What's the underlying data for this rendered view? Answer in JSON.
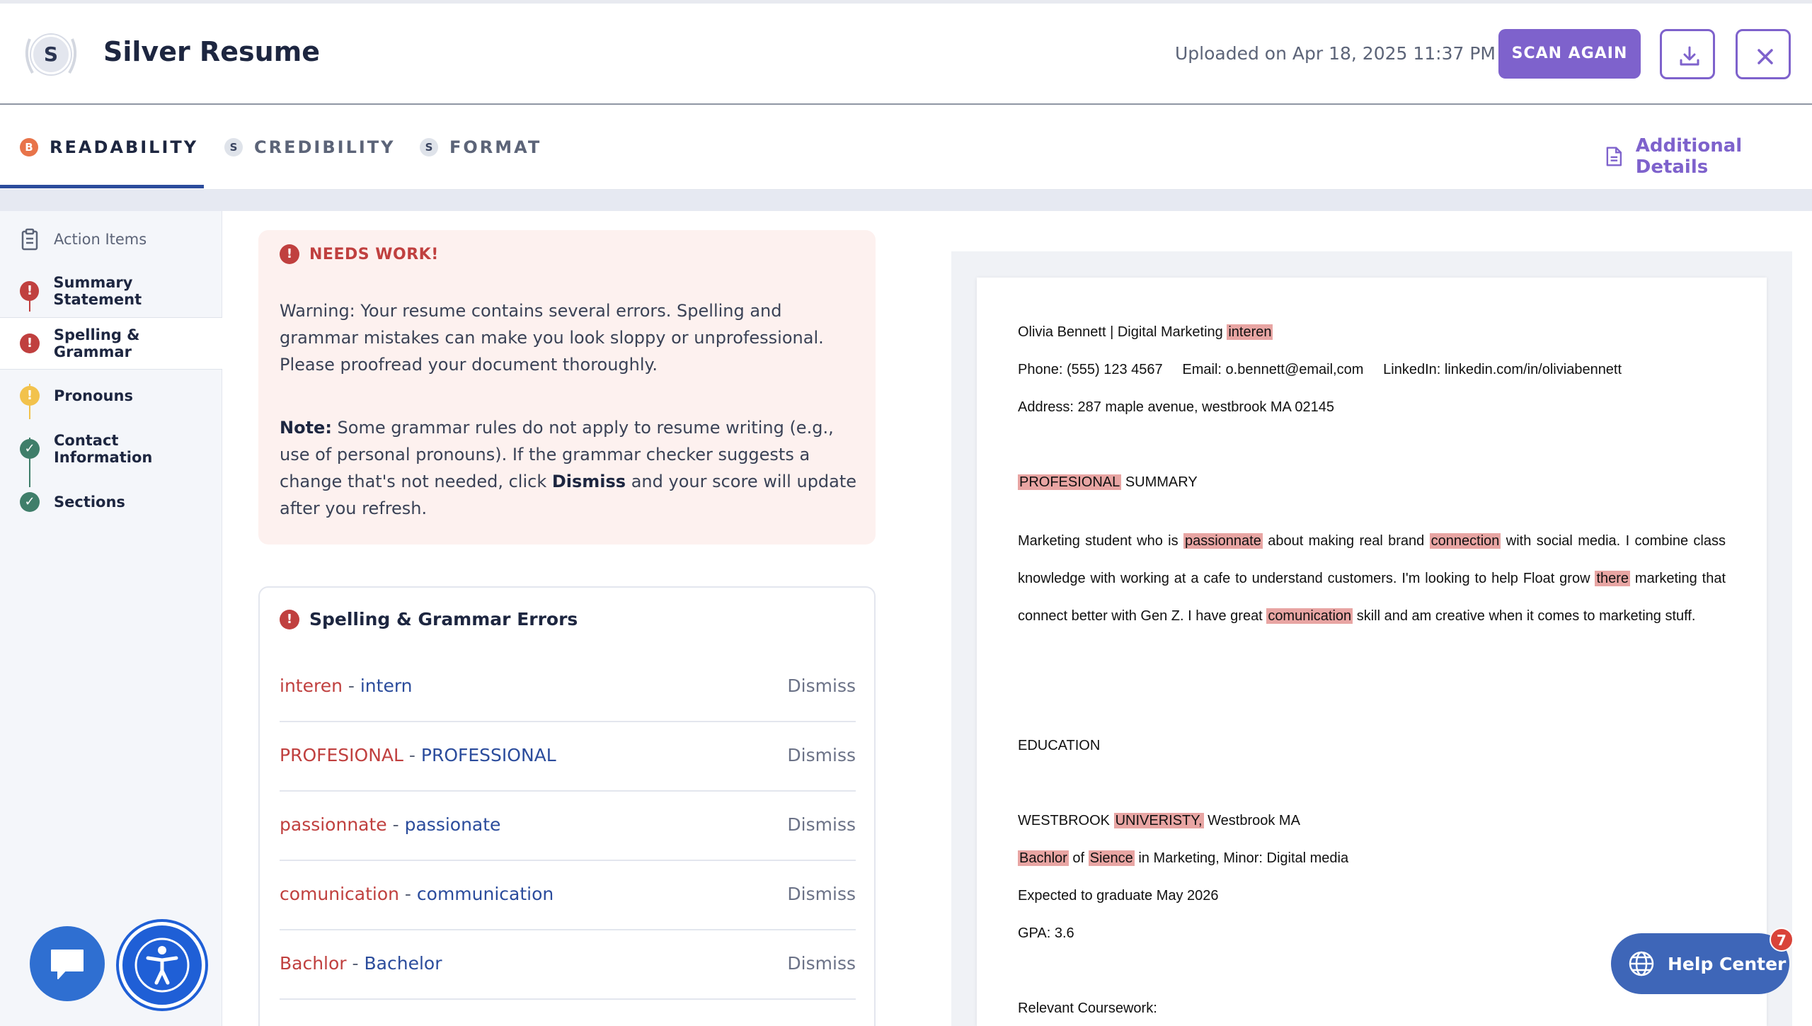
{
  "header": {
    "logo_letter": "S",
    "title": "Silver Resume",
    "uploaded": "Uploaded on Apr 18, 2025 11:37 PM",
    "scan_again": "SCAN AGAIN",
    "download_icon": "download-icon",
    "close_icon": "close-icon"
  },
  "tabs": [
    {
      "badge": "B",
      "label": "READABILITY",
      "active": true,
      "badge_color": "#e8744a"
    },
    {
      "badge": "S",
      "label": "CREDIBILITY",
      "active": false
    },
    {
      "badge": "S",
      "label": "FORMAT",
      "active": false
    }
  ],
  "additional_details": "Additional Details",
  "sidebar": {
    "items": [
      {
        "label": "Action Items",
        "icon": "clipboard-icon"
      },
      {
        "label": "Summary Statement",
        "status": "error"
      },
      {
        "label": "Spelling & Grammar",
        "status": "error",
        "active": true
      },
      {
        "label": "Pronouns",
        "status": "warning"
      },
      {
        "label": "Contact Information",
        "status": "ok"
      },
      {
        "label": "Sections",
        "status": "ok"
      }
    ]
  },
  "alert": {
    "title": "NEEDS WORK!",
    "body": "Warning: Your resume contains several errors. Spelling and grammar mistakes can make you look sloppy or unprofessional. Please proofread your document thoroughly.",
    "note_label": "Note:",
    "note_text_1": " Some grammar rules do not apply to resume writing (e.g., use of personal pronouns). If the grammar checker suggests a change that's not needed, click ",
    "note_dismiss": "Dismiss",
    "note_text_2": " and your score will update after you refresh."
  },
  "errors": {
    "title": "Spelling & Grammar Errors",
    "dismiss_label": "Dismiss",
    "items": [
      {
        "wrong": "interen",
        "right": "intern"
      },
      {
        "wrong": "PROFESIONAL",
        "right": "PROFESSIONAL"
      },
      {
        "wrong": "passionnate",
        "right": "passionate"
      },
      {
        "wrong": "comunication",
        "right": "communication"
      },
      {
        "wrong": "Bachlor",
        "right": "Bachelor"
      }
    ]
  },
  "resume": {
    "line1_a": "Olivia Bennett | Digital Marketing ",
    "line1_hl": "interen",
    "phone": "Phone: (555) 123 4567",
    "email": "Email: o.bennett@email,com",
    "linkedin": "LinkedIn: linkedin.com/in/oliviabennett",
    "address": "Address: 287 maple avenue, westbrook MA 02145",
    "summary_hl": "PROFESIONAL",
    "summary_rest": " SUMMARY",
    "p1": "Marketing student who is ",
    "p1_hl1": "passionnate",
    "p2": " about making real brand ",
    "p2_hl": "connection",
    "p3": " with social media. I combine class knowledge with working at a cafe to understand customers. I'm looking to help Float grow ",
    "p3_hl": "there",
    "p4": " marketing that connect better with Gen Z. I have great ",
    "p4_hl": "comunication",
    "p5": " skill and am creative when it comes to marketing stuff.",
    "education": "EDUCATION",
    "uni_a": "WESTBROOK ",
    "uni_hl": "UNIVERISTY,",
    "uni_b": " Westbrook MA",
    "deg_hl1": "Bachlor",
    "deg_of": " of ",
    "deg_hl2": "Sience",
    "deg_rest": " in Marketing, Minor: Digital media",
    "expected": "Expected to graduate May 2026",
    "gpa": "GPA: 3.6",
    "coursework": "Relevant Coursework:"
  },
  "help": {
    "label": "Help Center",
    "badge": "7"
  },
  "colors": {
    "accent": "#7e62cc",
    "error": "#c0403f",
    "fix": "#2b4c9c",
    "highlight": "#e8a5a3"
  }
}
